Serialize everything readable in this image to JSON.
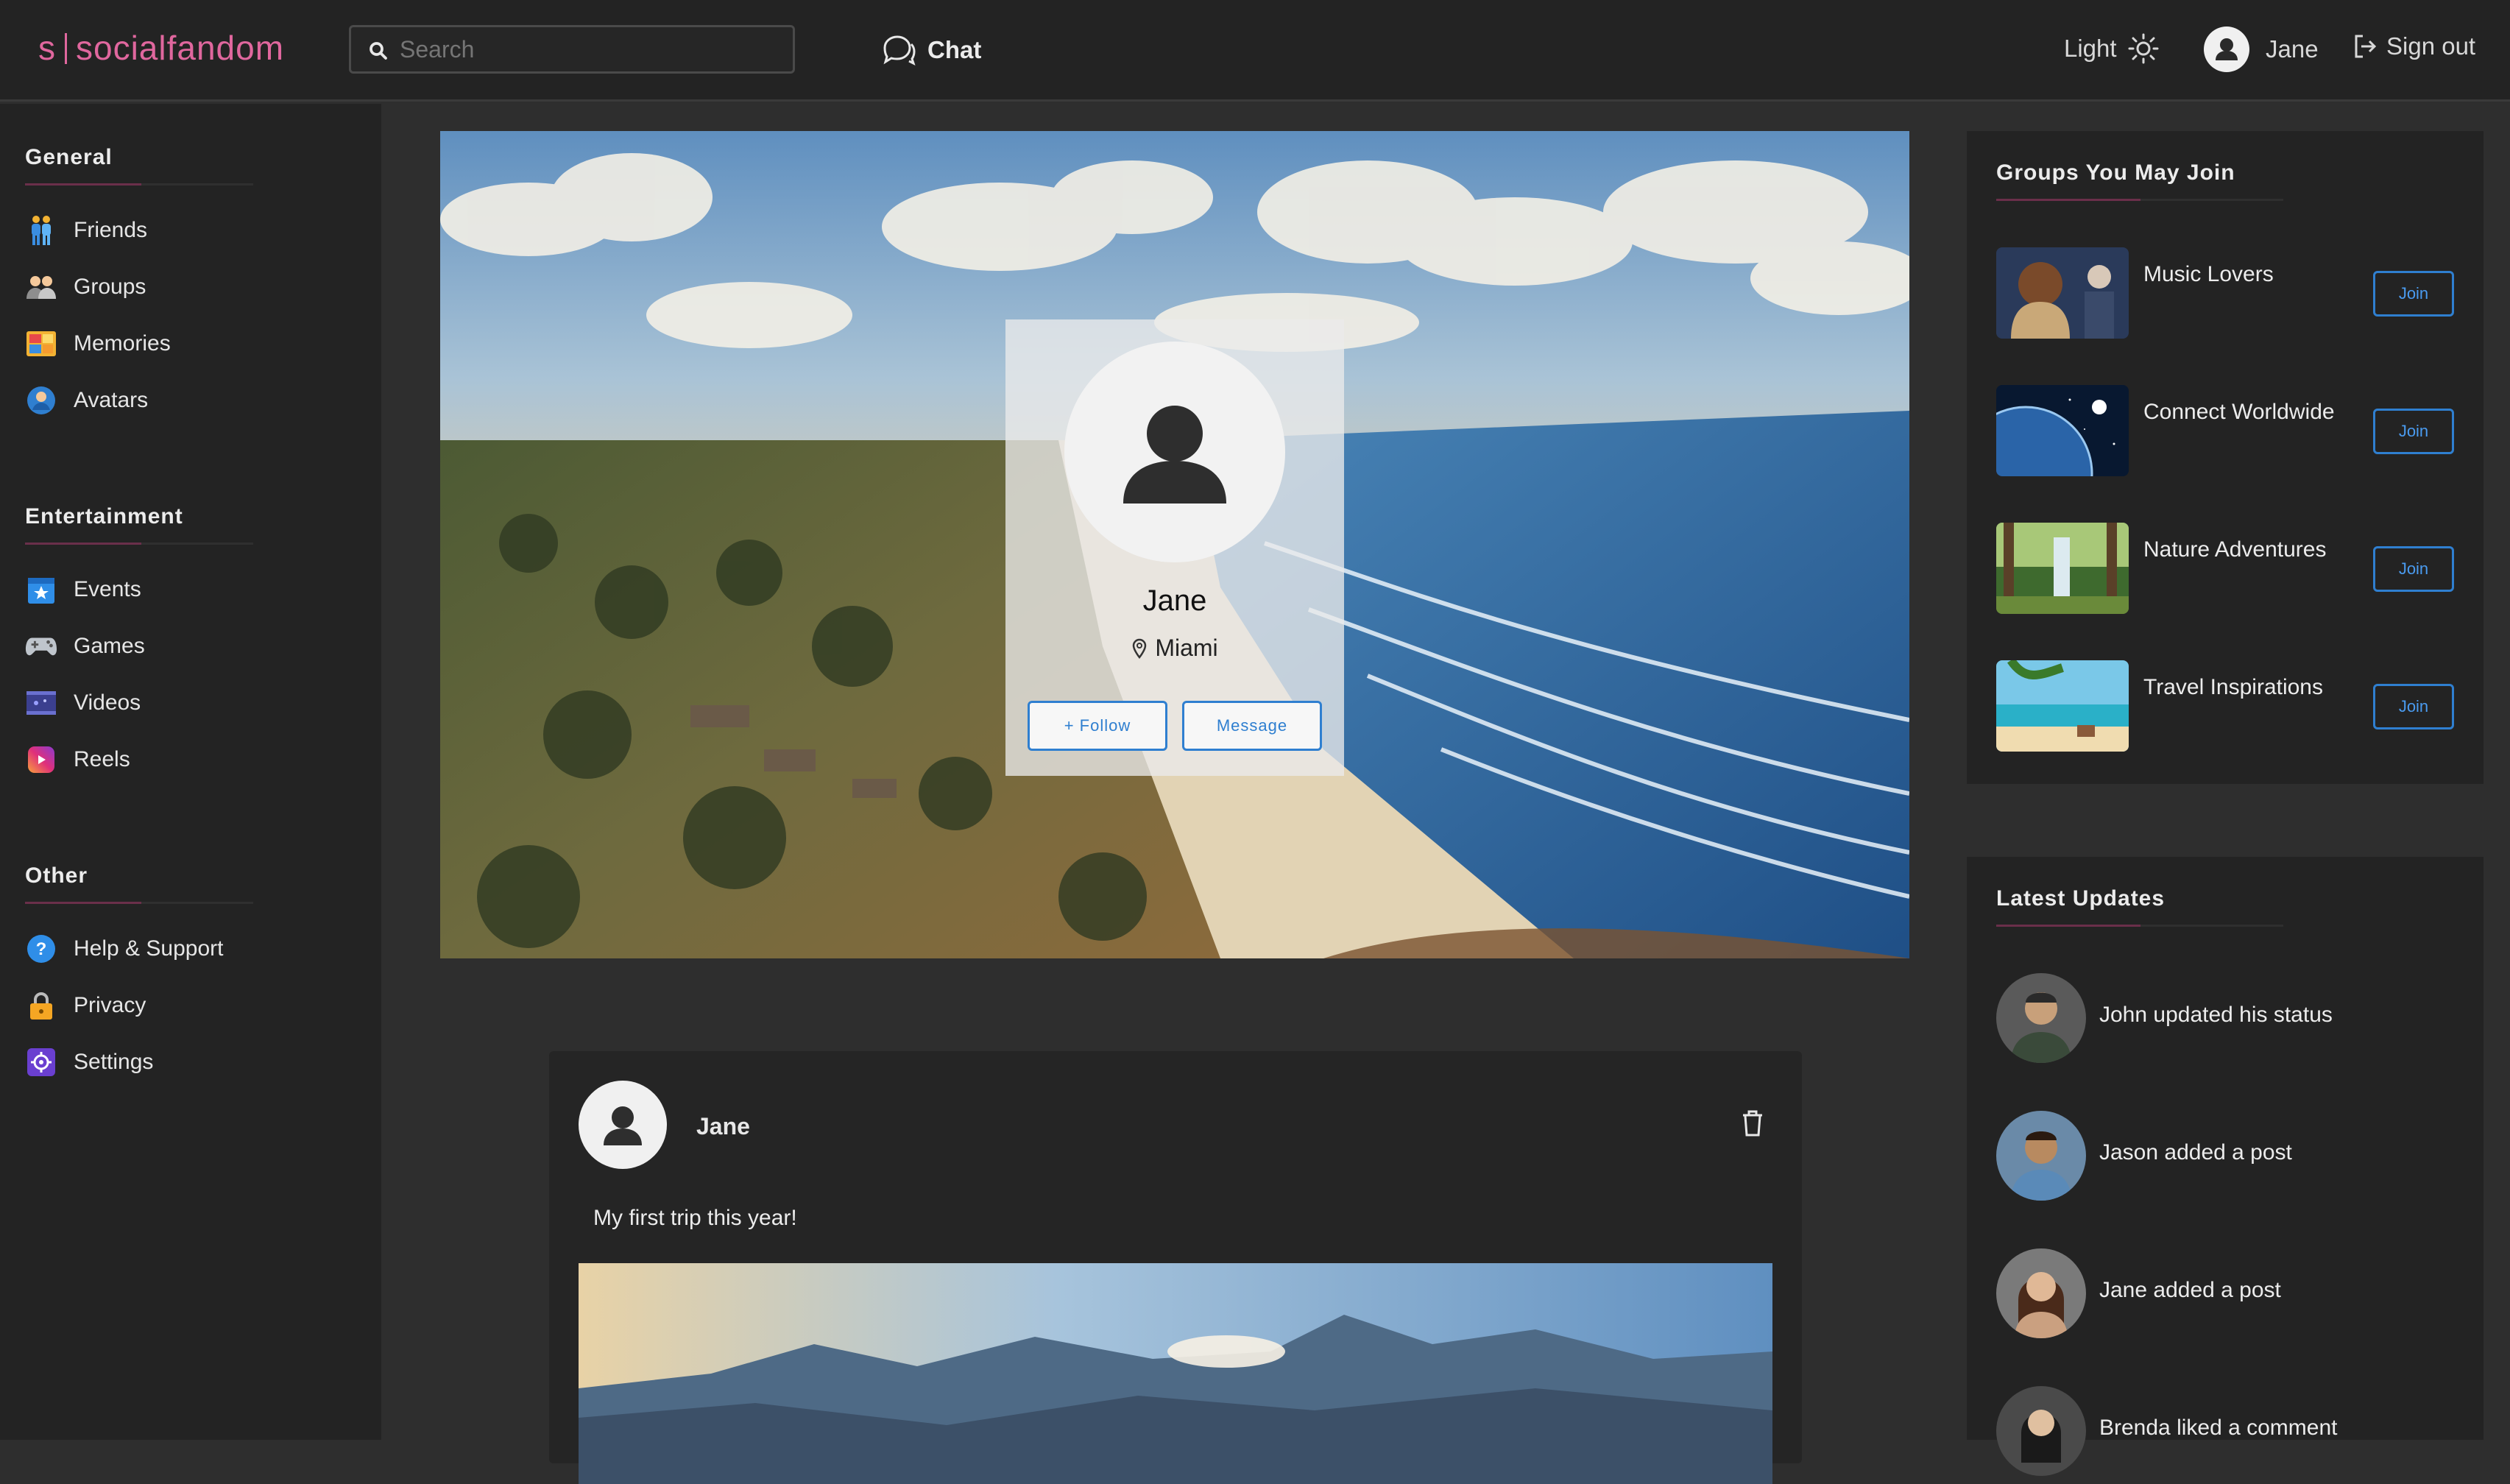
{
  "brand": {
    "prefix": "s",
    "name": "socialfandom"
  },
  "search": {
    "placeholder": "Search"
  },
  "header": {
    "chat_label": "Chat",
    "theme_label": "Light",
    "user_name": "Jane",
    "signout_label": "Sign out"
  },
  "sidebar": {
    "sections": [
      {
        "title": "General",
        "items": [
          {
            "label": "Friends",
            "icon": "friends-icon"
          },
          {
            "label": "Groups",
            "icon": "groups-icon"
          },
          {
            "label": "Memories",
            "icon": "memories-icon"
          },
          {
            "label": "Avatars",
            "icon": "avatars-icon"
          }
        ]
      },
      {
        "title": "Entertainment",
        "items": [
          {
            "label": "Events",
            "icon": "events-icon"
          },
          {
            "label": "Games",
            "icon": "gamepad-icon"
          },
          {
            "label": "Videos",
            "icon": "videos-icon"
          },
          {
            "label": "Reels",
            "icon": "reels-icon"
          }
        ]
      },
      {
        "title": "Other",
        "items": [
          {
            "label": "Help & Support",
            "icon": "help-icon"
          },
          {
            "label": "Privacy",
            "icon": "lock-icon"
          },
          {
            "label": "Settings",
            "icon": "settings-icon"
          }
        ]
      }
    ]
  },
  "profile": {
    "name": "Jane",
    "location": "Miami",
    "follow_label": "+ Follow",
    "message_label": "Message"
  },
  "post": {
    "author": "Jane",
    "text": "My first trip this year!"
  },
  "groups_panel": {
    "title": "Groups You May Join",
    "groups": [
      {
        "name": "Music Lovers",
        "join_label": "Join"
      },
      {
        "name": "Connect Worldwide",
        "join_label": "Join"
      },
      {
        "name": "Nature Adventures",
        "join_label": "Join"
      },
      {
        "name": "Travel Inspirations",
        "join_label": "Join"
      }
    ]
  },
  "updates_panel": {
    "title": "Latest Updates",
    "updates": [
      {
        "text": "John updated his status"
      },
      {
        "text": "Jason added a post"
      },
      {
        "text": "Jane added a post"
      },
      {
        "text": "Brenda liked a comment"
      }
    ]
  },
  "colors": {
    "accent": "#e0679e",
    "link_blue": "#2f7fd0",
    "bg": "#2e2e2e",
    "panel": "#232323"
  }
}
